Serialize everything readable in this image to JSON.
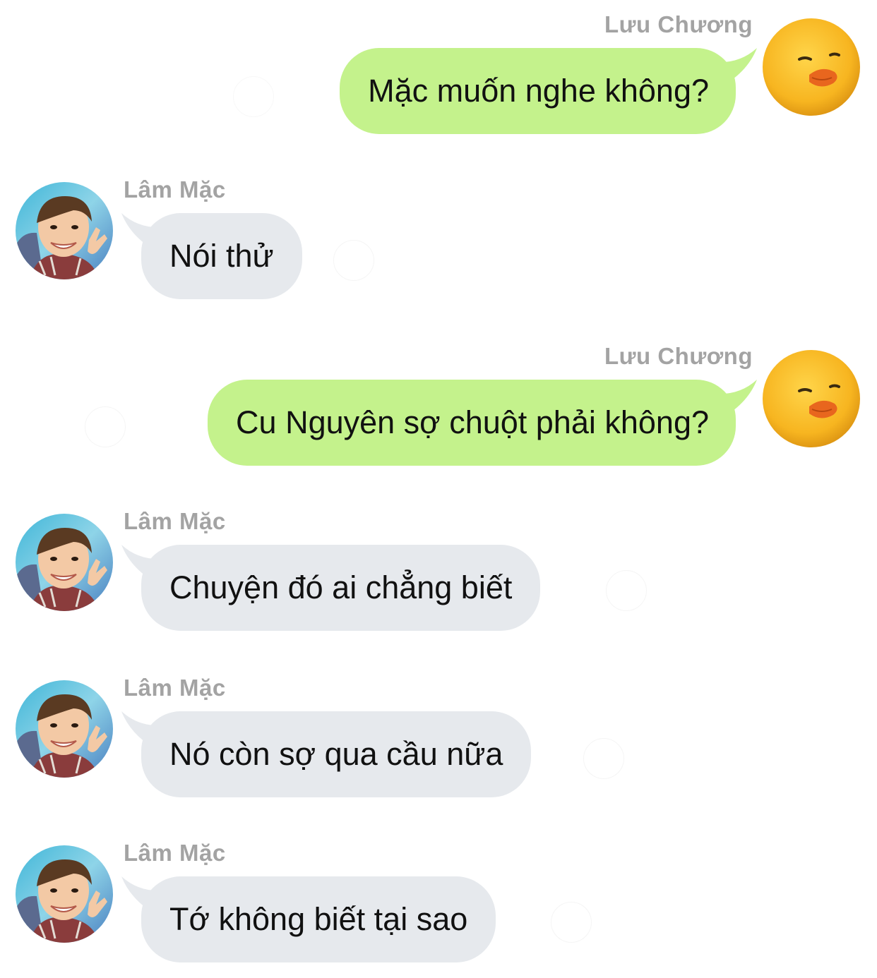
{
  "colors": {
    "outgoing_bubble": "#c4f28c",
    "incoming_bubble": "#e6e9ed",
    "sender_name": "#a3a3a3",
    "message_text": "#111111"
  },
  "reaction_icon": "add-reaction-icon",
  "messages": [
    {
      "direction": "outgoing",
      "sender": "Lưu Chương",
      "text": "Mặc muốn nghe không?",
      "avatar_icon": "duck-avatar"
    },
    {
      "direction": "incoming",
      "sender": "Lâm Mặc",
      "text": "Nói thử",
      "avatar_icon": "boy-avatar"
    },
    {
      "direction": "outgoing",
      "sender": "Lưu Chương",
      "text": "Cu Nguyên sợ chuột phải không?",
      "avatar_icon": "duck-avatar"
    },
    {
      "direction": "incoming",
      "sender": "Lâm Mặc",
      "text": "Chuyện đó ai chẳng biết",
      "avatar_icon": "boy-avatar"
    },
    {
      "direction": "incoming",
      "sender": "Lâm Mặc",
      "text": "Nó còn sợ qua cầu nữa",
      "avatar_icon": "boy-avatar"
    },
    {
      "direction": "incoming",
      "sender": "Lâm Mặc",
      "text": "Tớ không biết tại sao",
      "avatar_icon": "boy-avatar"
    }
  ]
}
